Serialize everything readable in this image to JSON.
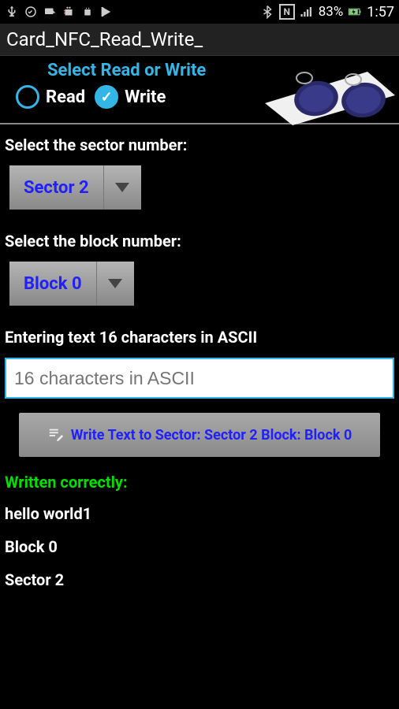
{
  "statusbar": {
    "battery_pct": "83%",
    "time": "1:57"
  },
  "app_title": "Card_NFC_Read_Write_",
  "header": {
    "title": "Select Read or Write",
    "read_label": "Read",
    "write_label": "Write",
    "selected": "write"
  },
  "sector": {
    "label": "Select the sector number:",
    "value": "Sector 2"
  },
  "block": {
    "label": "Select the block number:",
    "value": "Block 0"
  },
  "input": {
    "label": "Entering text 16 characters in ASCII",
    "placeholder": "16 characters in ASCII",
    "value": ""
  },
  "write_button": {
    "label": "Write Text to Sector: Sector 2 Block: Block 0"
  },
  "result": {
    "status": "Written correctly:",
    "lines": [
      "hello world1",
      "Block 0",
      "Sector 2"
    ]
  }
}
